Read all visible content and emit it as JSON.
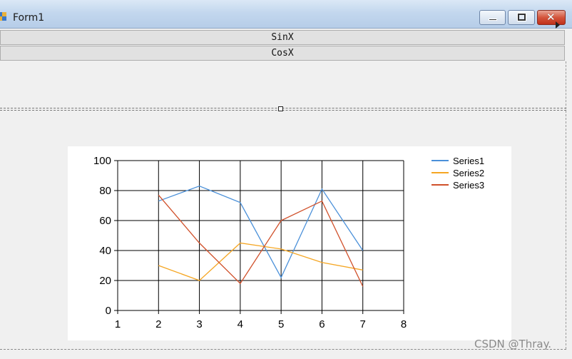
{
  "window": {
    "title": "Form1",
    "icon": "windows-forms-app-icon",
    "controls": [
      "minimize-icon",
      "maximize-icon",
      "close-icon"
    ]
  },
  "buttons": {
    "sinx": "SinX",
    "cosx": "CosX"
  },
  "chart_data": {
    "type": "line",
    "x": [
      2,
      3,
      4,
      5,
      6,
      7
    ],
    "xlim": [
      1,
      8
    ],
    "ylim": [
      0,
      100
    ],
    "xticks": [
      "1",
      "2",
      "3",
      "4",
      "5",
      "6",
      "7",
      "8"
    ],
    "yticks": [
      "0",
      "20",
      "40",
      "60",
      "80",
      "100"
    ],
    "grid": true,
    "legend_position": "top-right",
    "series": [
      {
        "name": "Series1",
        "color": "#4a90d9",
        "values": [
          73,
          83,
          72,
          22,
          81,
          40
        ]
      },
      {
        "name": "Series2",
        "color": "#f5a623",
        "values": [
          30,
          20,
          45,
          41,
          32,
          27
        ]
      },
      {
        "name": "Series3",
        "color": "#d0502a",
        "values": [
          77,
          45,
          18,
          60,
          73,
          16
        ]
      }
    ]
  },
  "watermark": "CSDN @Thray."
}
